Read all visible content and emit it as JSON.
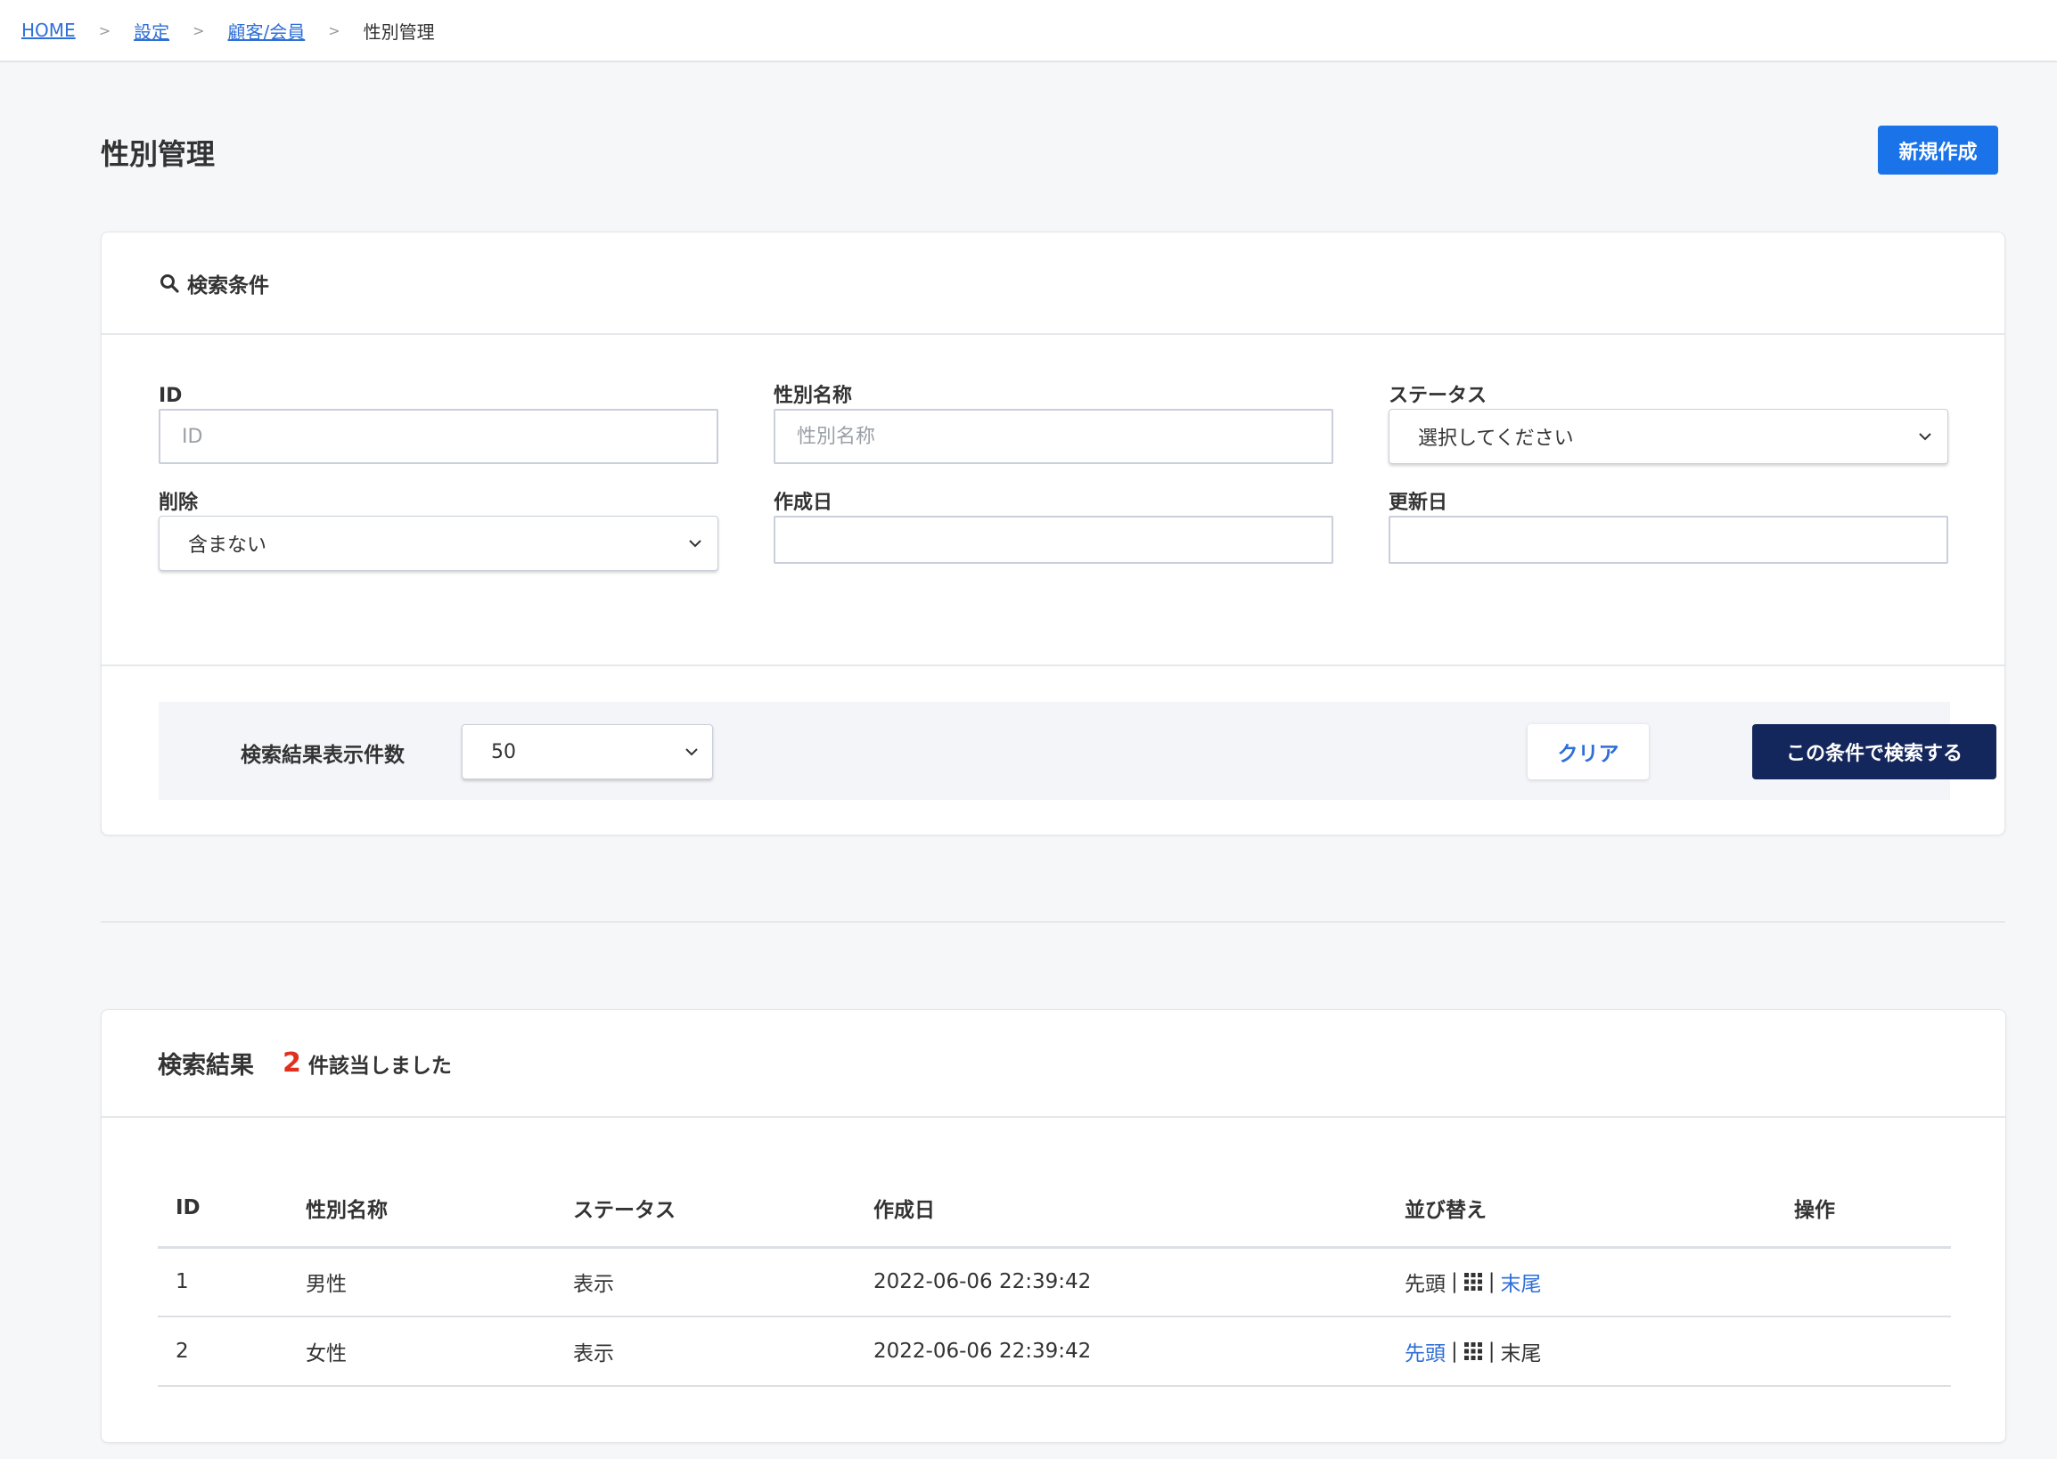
{
  "breadcrumb": {
    "items": [
      {
        "label": "HOME"
      },
      {
        "label": "設定"
      },
      {
        "label": "顧客/会員"
      }
    ],
    "separator": ">",
    "current": "性別管理"
  },
  "header": {
    "title": "性別管理",
    "new_button": "新規作成"
  },
  "search": {
    "title": "検索条件",
    "fields": {
      "id": {
        "label": "ID",
        "placeholder": "ID",
        "value": ""
      },
      "gender_name": {
        "label": "性別名称",
        "placeholder": "性別名称",
        "value": ""
      },
      "status": {
        "label": "ステータス",
        "selected": "選択してください"
      },
      "deleted": {
        "label": "削除",
        "selected": "含まない"
      },
      "created": {
        "label": "作成日",
        "value": ""
      },
      "updated": {
        "label": "更新日",
        "value": ""
      }
    },
    "count_label": "検索結果表示件数",
    "count_selected": "50",
    "clear_button": "クリア",
    "search_button": "この条件で検索する"
  },
  "results": {
    "title": "検索結果",
    "count": "2",
    "count_suffix": "件該当しました",
    "columns": [
      "ID",
      "性別名称",
      "ステータス",
      "作成日",
      "並び替え",
      "操作"
    ],
    "rows": [
      {
        "id": "1",
        "name": "男性",
        "status": "表示",
        "created": "2022-06-06 22:39:42",
        "sort_first": "先頭",
        "sort_last": "末尾",
        "first_active": false,
        "last_active": true
      },
      {
        "id": "2",
        "name": "女性",
        "status": "表示",
        "created": "2022-06-06 22:39:42",
        "sort_first": "先頭",
        "sort_last": "末尾",
        "first_active": true,
        "last_active": false
      }
    ],
    "sort_separator": "|"
  },
  "colors": {
    "accent": "#1a73e8",
    "primary_dark": "#14275c",
    "count_red": "#e0301e",
    "link": "#2f6fd6"
  },
  "icons": {
    "search": "search-icon",
    "chevron": "chevron-down-icon",
    "grip": "grid-drag-icon"
  }
}
